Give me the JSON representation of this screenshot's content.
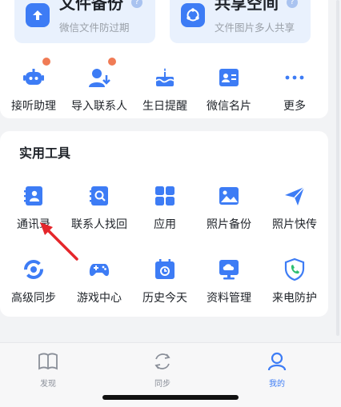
{
  "features": [
    {
      "title": "文件备份",
      "subtitle": "微信文件防过期"
    },
    {
      "title": "共享空间",
      "subtitle": "文件图片多人共享"
    }
  ],
  "quick_actions": [
    {
      "label": "接听助理",
      "icon": "robot-icon",
      "has_dot": true
    },
    {
      "label": "导入联系人",
      "icon": "import-contact-icon",
      "has_dot": true
    },
    {
      "label": "生日提醒",
      "icon": "cake-icon",
      "has_dot": false
    },
    {
      "label": "微信名片",
      "icon": "card-icon",
      "has_dot": false
    },
    {
      "label": "更多",
      "icon": "more-icon",
      "has_dot": false
    }
  ],
  "tools": {
    "title": "实用工具",
    "row1": [
      {
        "label": "通讯录",
        "icon": "contacts-icon"
      },
      {
        "label": "联系人找回",
        "icon": "contact-recover-icon"
      },
      {
        "label": "应用",
        "icon": "apps-icon"
      },
      {
        "label": "照片备份",
        "icon": "photo-backup-icon"
      },
      {
        "label": "照片快传",
        "icon": "photo-send-icon"
      }
    ],
    "row2": [
      {
        "label": "高级同步",
        "icon": "sync-icon"
      },
      {
        "label": "游戏中心",
        "icon": "gamepad-icon"
      },
      {
        "label": "历史今天",
        "icon": "calendar-icon"
      },
      {
        "label": "资料管理",
        "icon": "cloud-data-icon"
      },
      {
        "label": "来电防护",
        "icon": "phone-shield-icon"
      }
    ]
  },
  "tabs": [
    {
      "label": "发现",
      "icon": "book-icon"
    },
    {
      "label": "同步",
      "icon": "sync-tab-icon"
    },
    {
      "label": "我的",
      "icon": "user-icon",
      "active": true
    }
  ],
  "colors": {
    "accent": "#3d7cf5",
    "dot": "#f07b55",
    "arrow": "#e5262b"
  }
}
